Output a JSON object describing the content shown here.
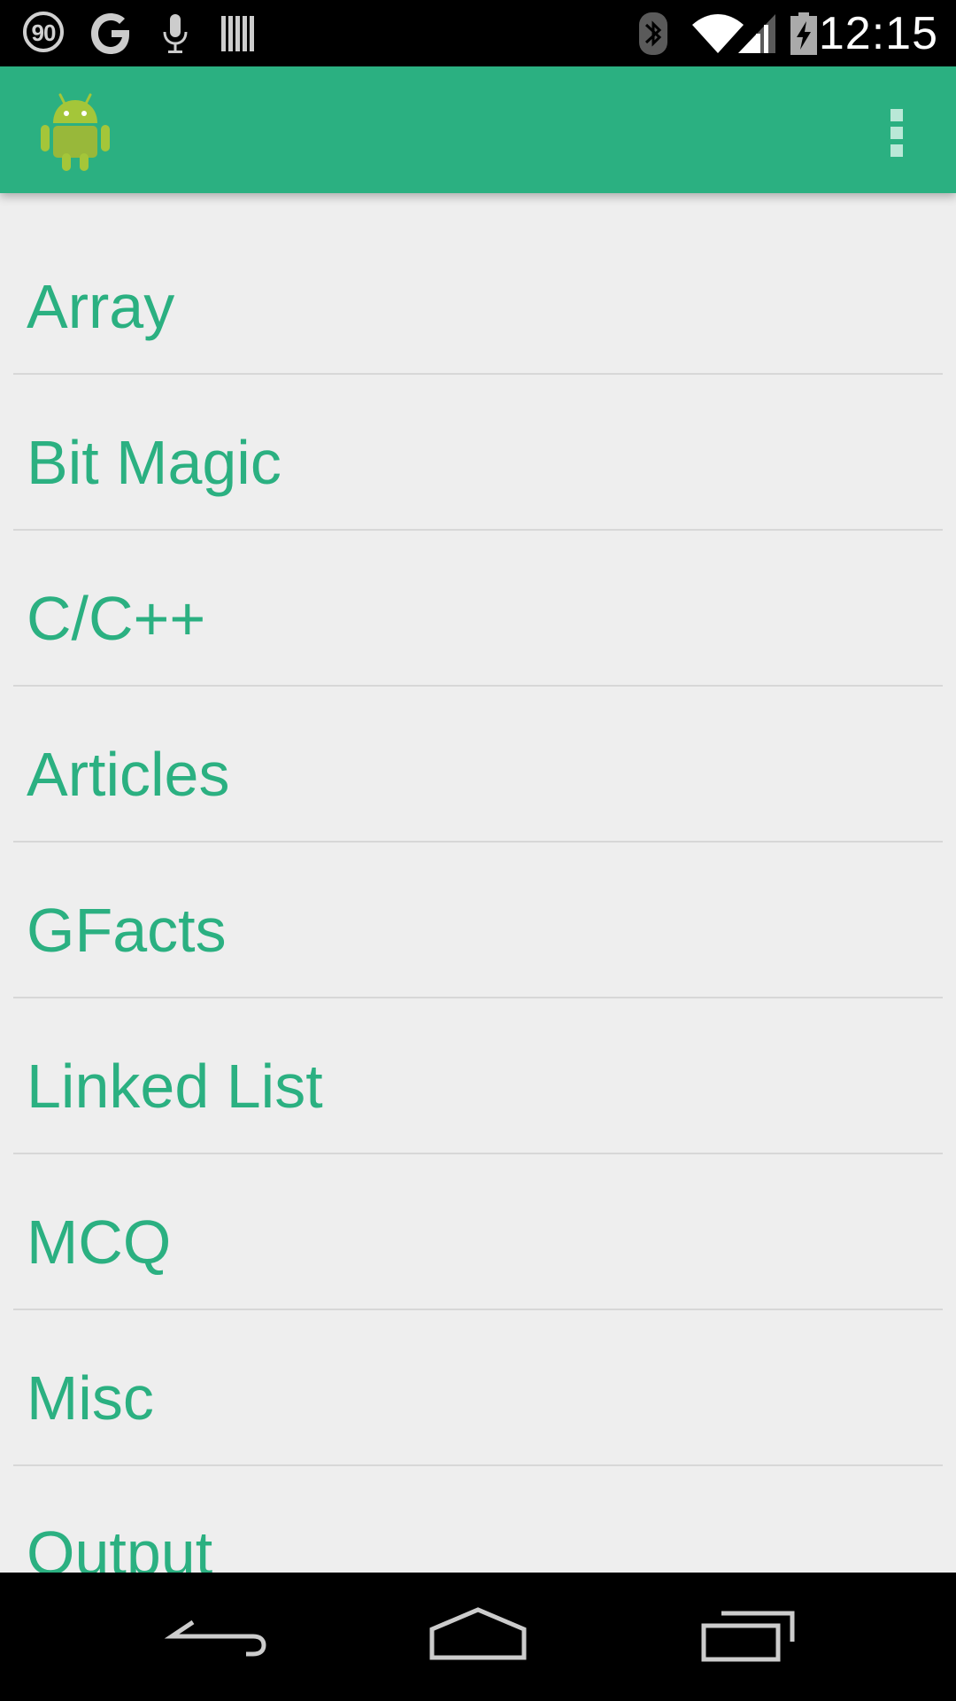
{
  "status_bar": {
    "badge_text": "90",
    "time": "12:15",
    "icons": [
      "speed-badge-icon",
      "google-icon",
      "microphone-icon",
      "barcode-icon",
      "bluetooth-icon",
      "wifi-icon",
      "cell-signal-icon",
      "battery-charging-icon"
    ]
  },
  "app_bar": {
    "logo_icon": "android-icon",
    "menu_icon": "overflow-menu-icon",
    "accent_color": "#2bb081"
  },
  "list": {
    "text_color": "#2bb081",
    "items": [
      {
        "label": "Array"
      },
      {
        "label": "Bit Magic"
      },
      {
        "label": "C/C++"
      },
      {
        "label": "Articles"
      },
      {
        "label": "GFacts"
      },
      {
        "label": "Linked List"
      },
      {
        "label": "MCQ"
      },
      {
        "label": "Misc"
      },
      {
        "label": "Output"
      }
    ]
  },
  "nav_bar": {
    "icons": [
      "back-icon",
      "home-icon",
      "recent-apps-icon"
    ]
  }
}
